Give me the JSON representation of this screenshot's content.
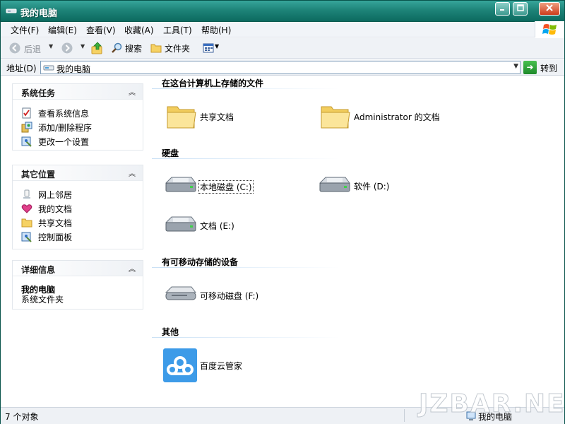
{
  "window": {
    "title": "我的电脑"
  },
  "menu": [
    "文件(F)",
    "编辑(E)",
    "查看(V)",
    "收藏(A)",
    "工具(T)",
    "帮助(H)"
  ],
  "toolbar": {
    "back": "后退",
    "search": "搜索",
    "folders": "文件夹"
  },
  "address": {
    "label": "地址(D)",
    "value": "我的电脑",
    "go": "转到"
  },
  "tasks_panel": {
    "title": "系统任务",
    "items": [
      {
        "label": "查看系统信息",
        "icon": "system-info-icon"
      },
      {
        "label": "添加/删除程序",
        "icon": "add-remove-programs-icon"
      },
      {
        "label": "更改一个设置",
        "icon": "control-panel-icon"
      }
    ]
  },
  "places_panel": {
    "title": "其它位置",
    "items": [
      {
        "label": "网上邻居",
        "icon": "network-icon"
      },
      {
        "label": "我的文档",
        "icon": "my-documents-icon"
      },
      {
        "label": "共享文档",
        "icon": "folder-icon"
      },
      {
        "label": "控制面板",
        "icon": "control-panel-icon"
      }
    ]
  },
  "details_panel": {
    "title": "详细信息",
    "name": "我的电脑",
    "desc": "系统文件夹"
  },
  "groups": {
    "files": {
      "title": "在这台计算机上存储的文件",
      "items": [
        {
          "label": "共享文档",
          "icon": "folder-icon"
        },
        {
          "label": "Administrator 的文档",
          "icon": "folder-icon"
        }
      ]
    },
    "drives": {
      "title": "硬盘",
      "items": [
        {
          "label": "本地磁盘 (C:)",
          "icon": "hard-drive-icon",
          "selected": true
        },
        {
          "label": "软件 (D:)",
          "icon": "hard-drive-icon"
        },
        {
          "label": "文档 (E:)",
          "icon": "hard-drive-icon"
        }
      ]
    },
    "removable": {
      "title": "有可移动存储的设备",
      "items": [
        {
          "label": "可移动磁盘 (F:)",
          "icon": "removable-drive-icon"
        }
      ]
    },
    "other": {
      "title": "其他",
      "items": [
        {
          "label": "百度云管家",
          "icon": "baidu-cloud-icon"
        }
      ]
    }
  },
  "status": {
    "count": "7 个对象",
    "location": "我的电脑"
  },
  "watermark": "JZBAR.NET",
  "colors": {
    "titlebar": "#1e8479",
    "menubar": "#f1f4f8",
    "panel_bg": "#ffffff",
    "go_green": "#2aa034",
    "baidu_blue": "#3d9be8"
  }
}
